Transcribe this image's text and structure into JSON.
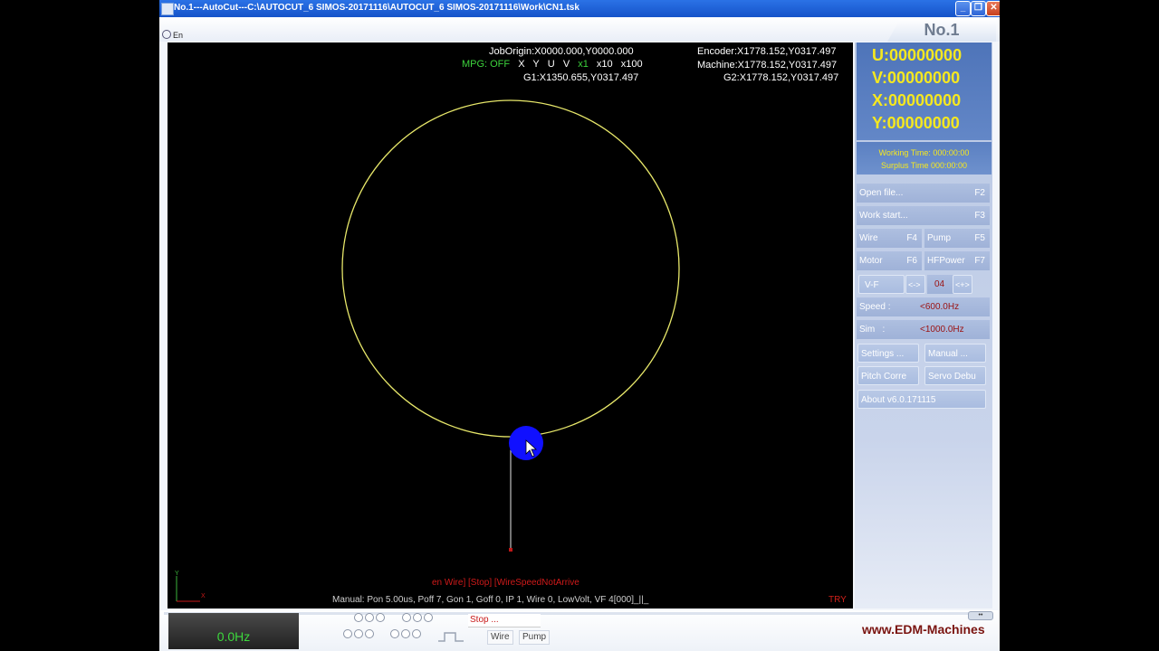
{
  "window": {
    "title": "No.1---AutoCut---C:\\AUTOCUT_6 SIMOS-20171116\\AUTOCUT_6 SIMOS-20171116\\Work\\CN1.tsk",
    "minimize": "_",
    "maximize": "❐",
    "close": "✕"
  },
  "menubar": {
    "language": "En",
    "machine_tab": "No.1"
  },
  "readouts": {
    "job_origin": "JobOrigin:X0000.000,Y0000.000",
    "encoder": "Encoder:X1778.152,Y0317.497",
    "machine": "Machine:X1778.152,Y0317.497",
    "g1": "G1:X1350.655,Y0317.497",
    "g2": "G2:X1778.152,Y0317.497"
  },
  "mpg": {
    "label": "MPG:",
    "state": "OFF",
    "axes": [
      "X",
      "Y",
      "U",
      "V"
    ],
    "multipliers": [
      "x1",
      "x10",
      "x100"
    ]
  },
  "status": {
    "alarms": "en Wire]  [Stop]  [WireSpeedNotArrive",
    "params": "Manual: Pon 5.00us, Poff 7, Gon 1, Goff 0, IP 1, Wire 0, LowVolt, VF 4[000]_||_",
    "mode": "TRY"
  },
  "counters": {
    "u": "U:00000000",
    "v": "V:00000000",
    "x": "X:00000000",
    "y": "Y:00000000"
  },
  "times": {
    "working": "Working Time: 000:00:00",
    "surplus": "Surplus Time 000:00:00"
  },
  "buttons": {
    "open_file": "Open file...",
    "open_file_key": "F2",
    "work_start": "Work start...",
    "work_start_key": "F3",
    "wire": "Wire",
    "wire_key": "F4",
    "pump": "Pump",
    "pump_key": "F5",
    "motor": "Motor",
    "motor_key": "F6",
    "hfpower": "HFPower",
    "hfpower_key": "F7",
    "vf": "V-F",
    "vf_dec": "<->",
    "vf_value": "04",
    "vf_inc": "<+>",
    "speed_label": "Speed :",
    "speed_value": "<600.0Hz",
    "sim_label": "Sim   :",
    "sim_value": "<1000.0Hz",
    "settings": "Settings ...",
    "manual": "Manual ...",
    "pitch": "Pitch Corre",
    "servo": "Servo Debu",
    "about": "About v6.0.171115"
  },
  "bottom": {
    "frequency": "0.0Hz",
    "stop": "Stop ...",
    "wire": "Wire",
    "pump": "Pump",
    "website": "www.EDM-Machines",
    "scroll": "••"
  },
  "colors": {
    "path": "#e8e86a",
    "cursor_circle": "#1010ff",
    "counter_text": "#f6e81f",
    "alarm_text": "#d01a1a"
  }
}
